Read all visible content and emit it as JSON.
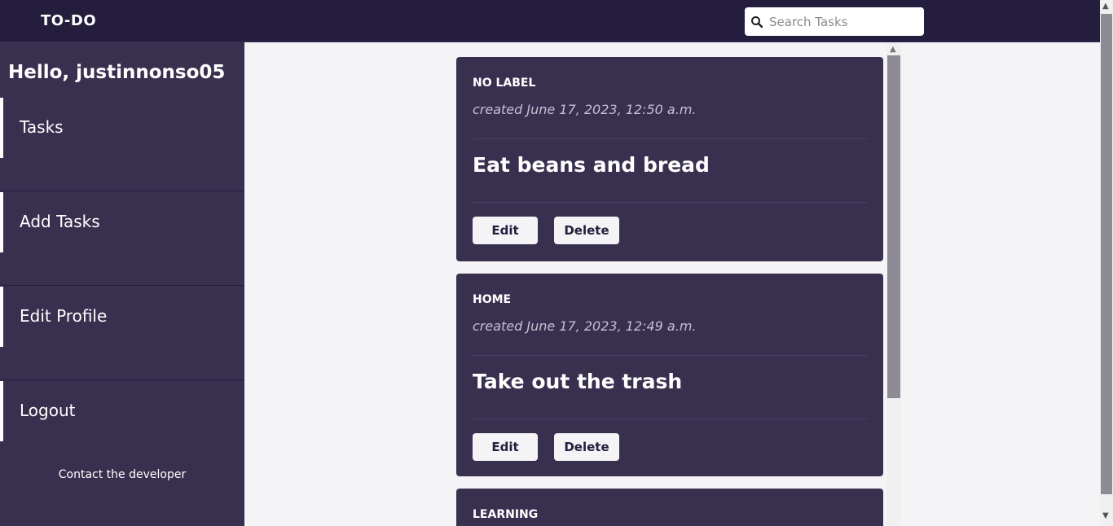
{
  "header": {
    "brand": "TO-DO",
    "search_placeholder": "Search Tasks"
  },
  "sidebar": {
    "greeting": "Hello, justinnonso05",
    "items": [
      {
        "label": "Tasks"
      },
      {
        "label": "Add Tasks"
      },
      {
        "label": "Edit Profile"
      },
      {
        "label": "Logout"
      }
    ],
    "contact": "Contact the developer"
  },
  "tasks": [
    {
      "category": "NO LABEL",
      "created": "created June 17, 2023, 12:50 a.m.",
      "title": "Eat beans and bread",
      "edit_label": "Edit",
      "delete_label": "Delete"
    },
    {
      "category": "HOME",
      "created": "created June 17, 2023, 12:49 a.m.",
      "title": "Take out the trash",
      "edit_label": "Edit",
      "delete_label": "Delete"
    },
    {
      "category": "LEARNING"
    }
  ],
  "colors": {
    "topbar": "#241d3d",
    "sidebar": "#39304f",
    "card": "#393050",
    "background": "#f4f3f6"
  }
}
